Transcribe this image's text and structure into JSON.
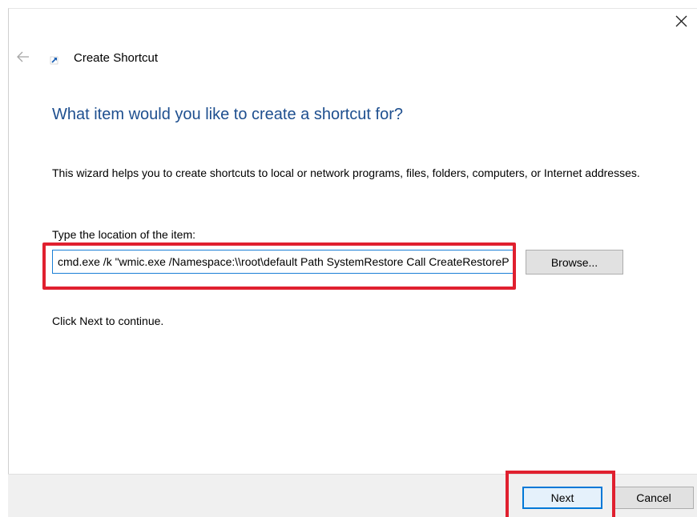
{
  "window": {
    "title": "Create Shortcut"
  },
  "icons": {
    "close": "close-icon",
    "back": "back-arrow-icon",
    "wizard": "shortcut-arrow-icon"
  },
  "page": {
    "heading": "What item would you like to create a shortcut for?",
    "description": "This wizard helps you to create shortcuts to local or network programs, files, folders, computers, or Internet addresses.",
    "location_label": "Type the location of the item:",
    "location_value": "cmd.exe /k \"wmic.exe /Namespace:\\\\root\\default Path SystemRestore Call CreateRestorePoint",
    "browse_label": "Browse...",
    "continue_text": "Click Next to continue."
  },
  "footer": {
    "next_label": "Next",
    "cancel_label": "Cancel"
  },
  "colors": {
    "heading": "#1e4f8f",
    "highlight": "#e0202f",
    "focus": "#0078d7"
  }
}
